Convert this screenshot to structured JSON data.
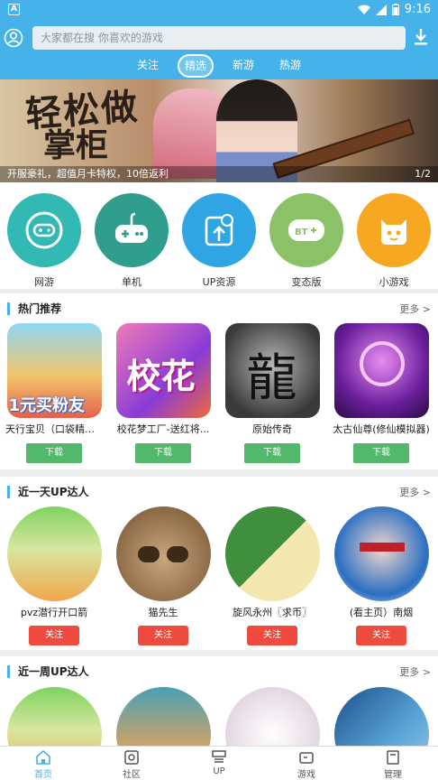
{
  "status": {
    "time": "9:16"
  },
  "search": {
    "placeholder": "大家都在搜 你喜欢的游戏"
  },
  "tabs": [
    {
      "label": "关注"
    },
    {
      "label": "精选"
    },
    {
      "label": "新游"
    },
    {
      "label": "热游"
    }
  ],
  "banner": {
    "caption": "开服豪礼，超值月卡特权，10倍返利",
    "pager": "1/2",
    "art_text_1": "轻松做",
    "art_text_2": "掌柜"
  },
  "categories": [
    {
      "label": "网游",
      "color": "#32b9b3"
    },
    {
      "label": "单机",
      "color": "#2f9e8d"
    },
    {
      "label": "UP资源",
      "color": "#2fa6e3"
    },
    {
      "label": "变态版",
      "color": "#8cc267"
    },
    {
      "label": "小游戏",
      "color": "#f7a823"
    }
  ],
  "hot": {
    "title": "热门推荐",
    "more": "更多 >",
    "items": [
      {
        "name": "天行宝贝（口袋精灵...",
        "button": "下载",
        "art": "1元买粉友"
      },
      {
        "name": "校花梦工厂-送红将...",
        "button": "下载",
        "art": "校花"
      },
      {
        "name": "原始传奇",
        "button": "下载",
        "art": "龍"
      },
      {
        "name": "太古仙尊(修仙模拟器)",
        "button": "下载",
        "art": ""
      }
    ]
  },
  "day": {
    "title": "近一天UP达人",
    "more": "更多 >",
    "items": [
      {
        "name": "pvz潜行开口箭",
        "button": "关注"
      },
      {
        "name": "猫先生",
        "button": "关注"
      },
      {
        "name": "旋风永州〖求币〗",
        "button": "关注"
      },
      {
        "name": "(看主页）南烟",
        "button": "关注"
      }
    ]
  },
  "week": {
    "title": "近一周UP达人",
    "more": "更多 >"
  },
  "nav": [
    {
      "label": "首页"
    },
    {
      "label": "社区"
    },
    {
      "label": "UP"
    },
    {
      "label": "游戏"
    },
    {
      "label": "管理"
    }
  ],
  "colors": {
    "primary": "#45b3ea",
    "download": "#52b86b",
    "follow": "#ee4b3e"
  }
}
